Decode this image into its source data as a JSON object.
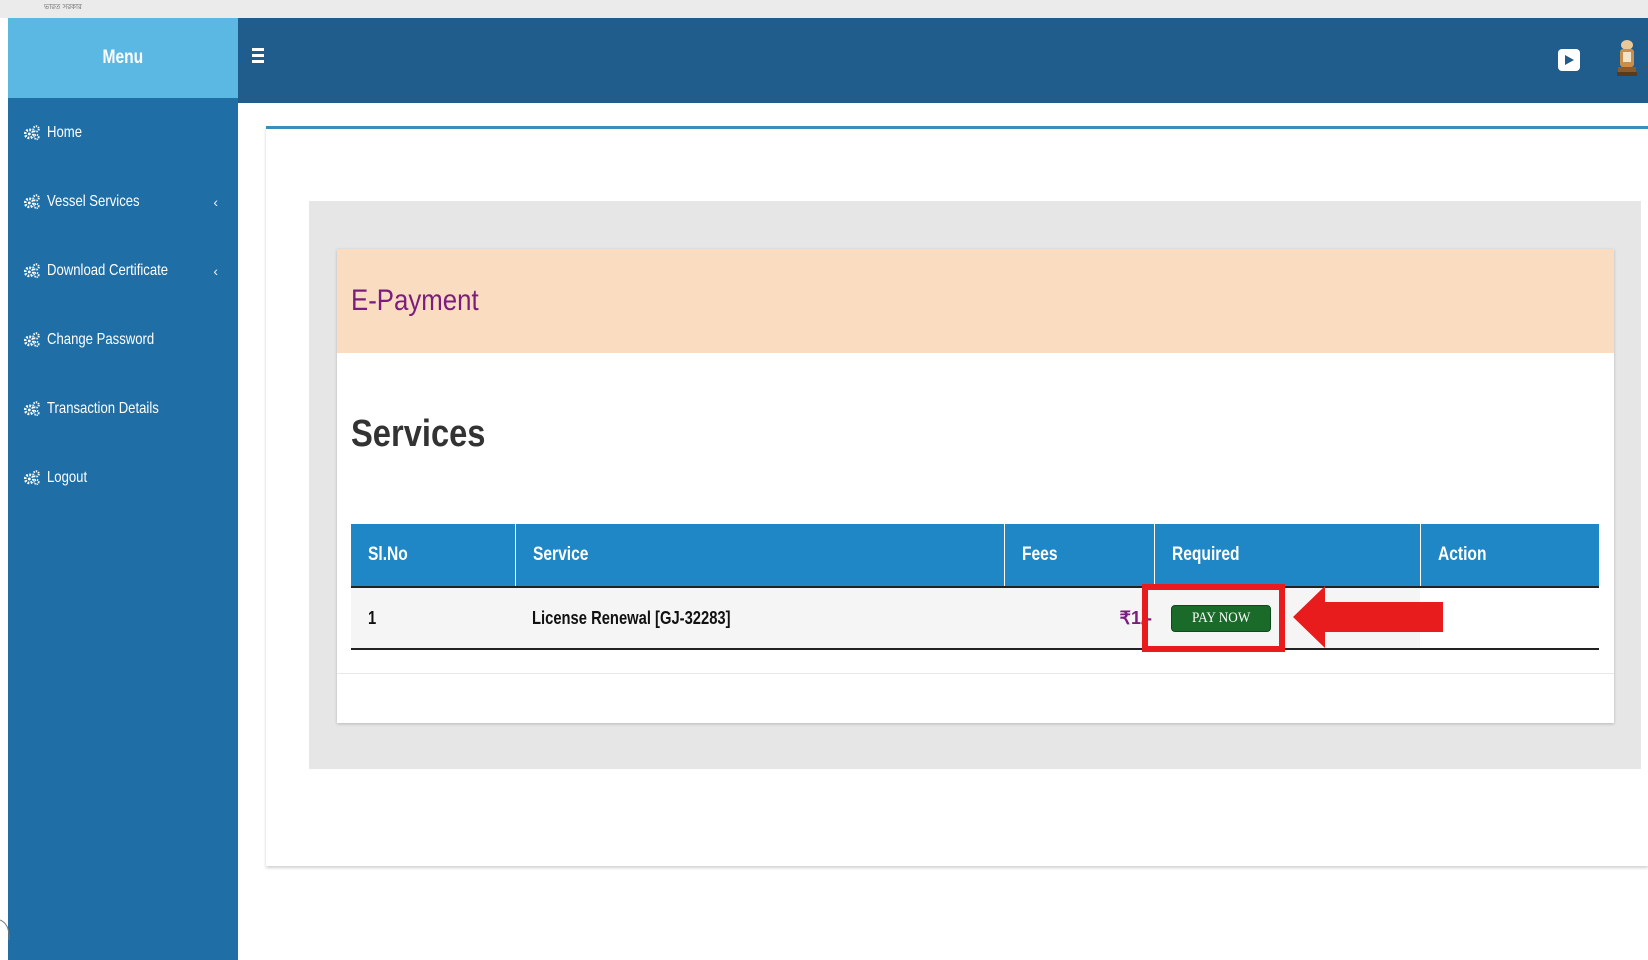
{
  "topstrip": {
    "text": "ভারত সরকার"
  },
  "sidebar": {
    "title": "Menu",
    "items": [
      {
        "label": "Home",
        "has_submenu": false
      },
      {
        "label": "Vessel Services",
        "has_submenu": true
      },
      {
        "label": "Download Certificate",
        "has_submenu": true
      },
      {
        "label": "Change Password",
        "has_submenu": false
      },
      {
        "label": "Transaction Details",
        "has_submenu": false
      },
      {
        "label": "Logout",
        "has_submenu": false
      }
    ],
    "chevron": "‹"
  },
  "topbar": {
    "menu_icon": "hamburger-icon",
    "play_icon": "play-icon",
    "avatar_icon": "emblem-avatar"
  },
  "card": {
    "title": "E-Payment"
  },
  "services": {
    "heading": "Services",
    "columns": [
      "Sl.No",
      "Service",
      "Fees",
      "Required",
      "Action"
    ],
    "rows": [
      {
        "sl": "1",
        "service": "License Renewal [GJ-32283]",
        "fees": "₹1/-",
        "required_button": "PAY NOW",
        "action": ""
      }
    ]
  },
  "colors": {
    "sidebar": "#1f6ea6",
    "topbar": "#215d8c",
    "table_header": "#1f87c5",
    "card_header": "#fadcc1",
    "pay_button": "#1a6b2a",
    "highlight": "#e81c1c"
  }
}
